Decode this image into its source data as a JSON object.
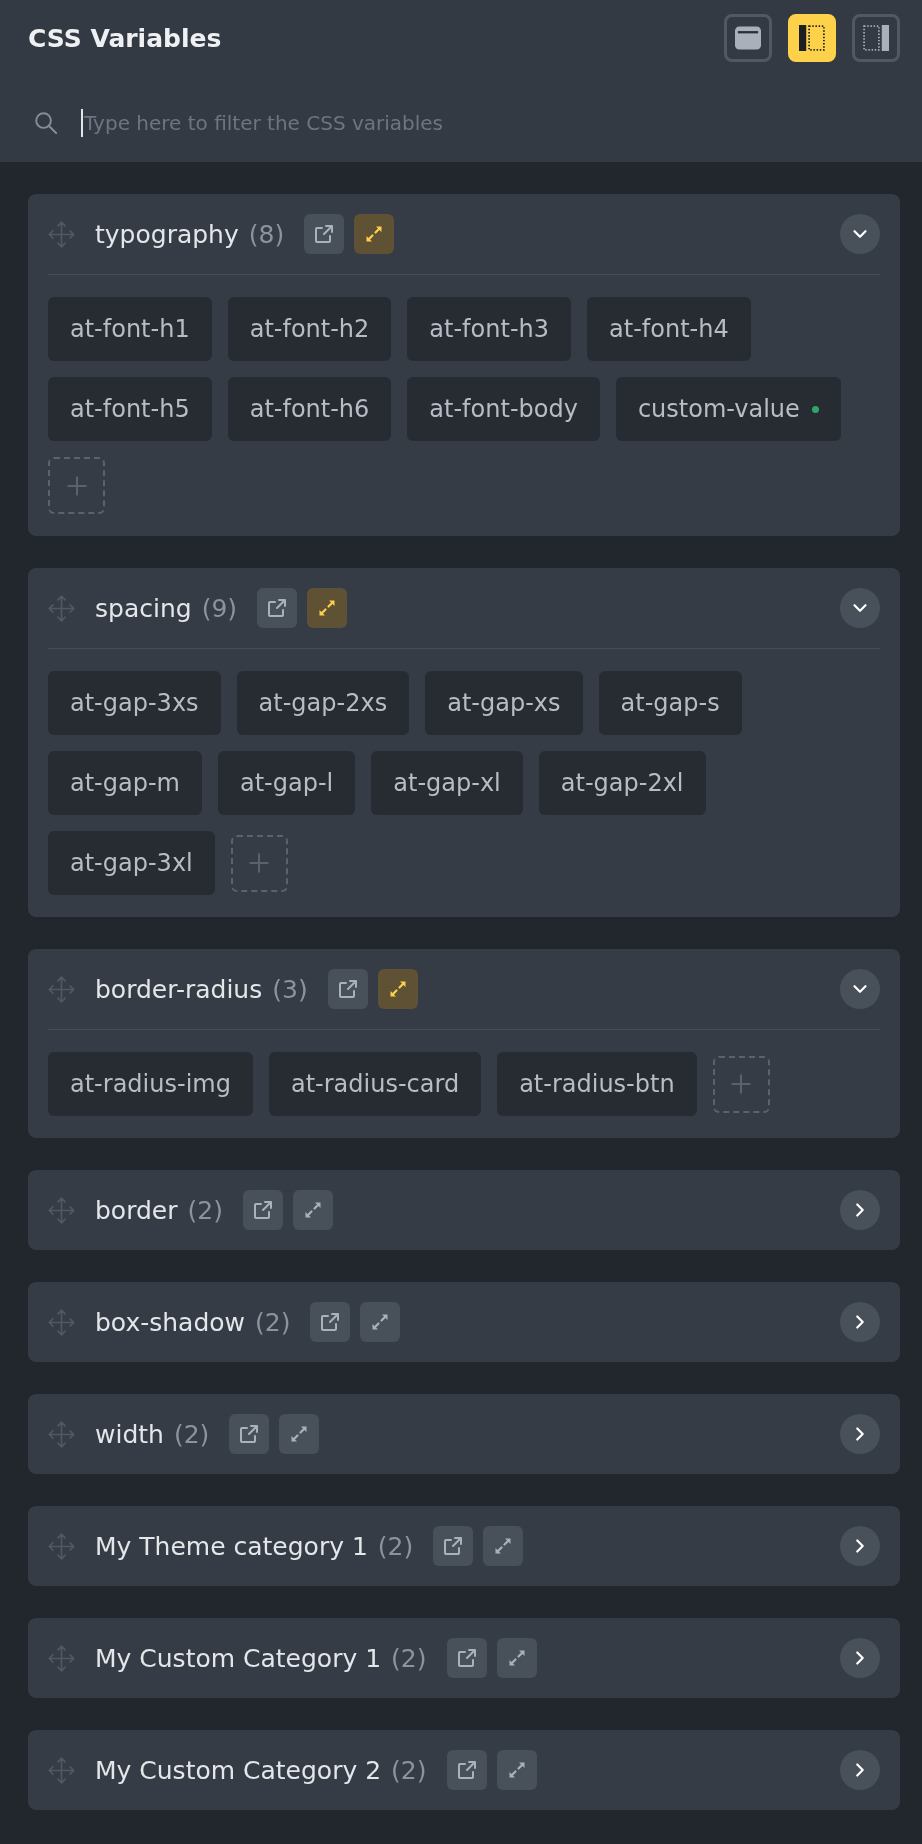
{
  "header": {
    "title": "CSS Variables",
    "layout_options": [
      {
        "kind": "window",
        "selected": false
      },
      {
        "kind": "left_panel",
        "selected": true
      },
      {
        "kind": "right_panel",
        "selected": false
      }
    ]
  },
  "search": {
    "placeholder": "Type here to filter the CSS variables",
    "focused": true
  },
  "categories": [
    {
      "name": "typography",
      "count": "(8)",
      "expanded": true,
      "variables": [
        {
          "name": "at-font-h1",
          "modified": false
        },
        {
          "name": "at-font-h2",
          "modified": false
        },
        {
          "name": "at-font-h3",
          "modified": false
        },
        {
          "name": "at-font-h4",
          "modified": false
        },
        {
          "name": "at-font-h5",
          "modified": false
        },
        {
          "name": "at-font-h6",
          "modified": false
        },
        {
          "name": "at-font-body",
          "modified": false
        },
        {
          "name": "custom-value",
          "modified": true
        }
      ]
    },
    {
      "name": "spacing",
      "count": "(9)",
      "expanded": true,
      "variables": [
        {
          "name": "at-gap-3xs",
          "modified": false
        },
        {
          "name": "at-gap-2xs",
          "modified": false
        },
        {
          "name": "at-gap-xs",
          "modified": false
        },
        {
          "name": "at-gap-s",
          "modified": false
        },
        {
          "name": "at-gap-m",
          "modified": false
        },
        {
          "name": "at-gap-l",
          "modified": false
        },
        {
          "name": "at-gap-xl",
          "modified": false
        },
        {
          "name": "at-gap-2xl",
          "modified": false
        },
        {
          "name": "at-gap-3xl",
          "modified": false
        }
      ]
    },
    {
      "name": "border-radius",
      "count": "(3)",
      "expanded": true,
      "variables": [
        {
          "name": "at-radius-img",
          "modified": false
        },
        {
          "name": "at-radius-card",
          "modified": false
        },
        {
          "name": "at-radius-btn",
          "modified": false
        }
      ]
    },
    {
      "name": "border",
      "count": "(2)",
      "expanded": false
    },
    {
      "name": "box-shadow",
      "count": "(2)",
      "expanded": false
    },
    {
      "name": "width",
      "count": "(2)",
      "expanded": false
    },
    {
      "name": "My Theme category 1",
      "count": "(2)",
      "expanded": false
    },
    {
      "name": "My Custom Category 1",
      "count": "(2)",
      "expanded": false
    },
    {
      "name": "My Custom Category 2",
      "count": "(2)",
      "expanded": false
    }
  ]
}
